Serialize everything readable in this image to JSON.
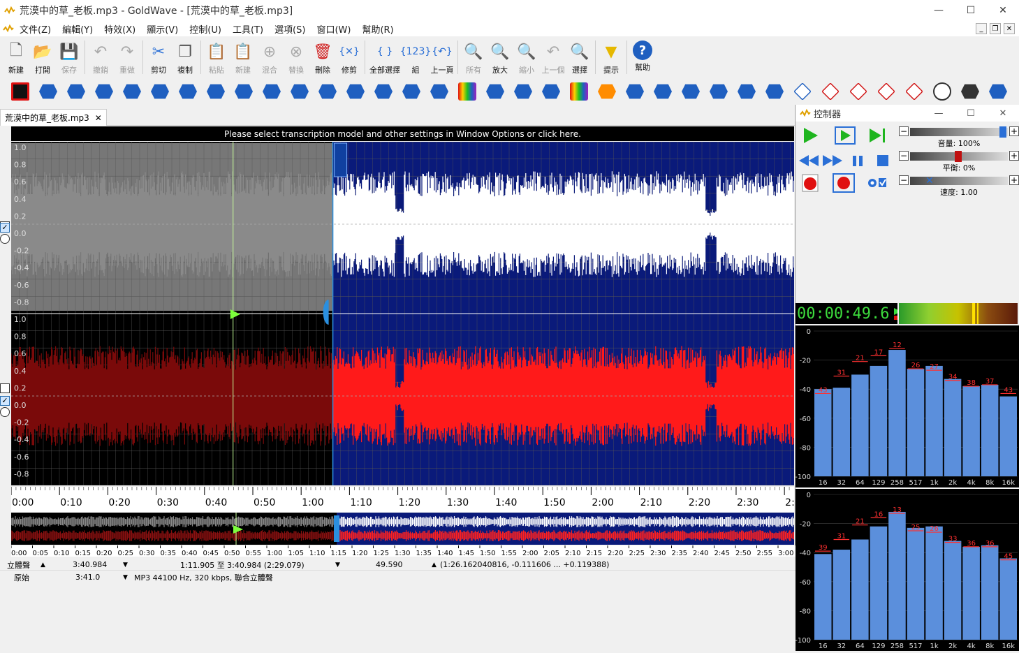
{
  "window": {
    "title": "荒漠中的草_老板.mp3 - GoldWave - [荒漠中的草_老板.mp3]",
    "controls": {
      "minimize": "—",
      "maximize": "☐",
      "close": "✕"
    }
  },
  "menu": [
    "文件(Z)",
    "編輯(Y)",
    "特效(X)",
    "顯示(V)",
    "控制(U)",
    "工具(T)",
    "選項(S)",
    "窗口(W)",
    "幫助(R)"
  ],
  "toolbar": [
    {
      "label": "新建",
      "icon": "new-file-icon",
      "glyph": "🗋",
      "enabled": true
    },
    {
      "label": "打開",
      "icon": "open-file-icon",
      "glyph": "📂",
      "enabled": true
    },
    {
      "label": "保存",
      "icon": "save-icon",
      "glyph": "💾",
      "enabled": false
    },
    {
      "label": "撤銷",
      "icon": "undo-icon",
      "glyph": "↶",
      "enabled": false
    },
    {
      "label": "重做",
      "icon": "redo-icon",
      "glyph": "↷",
      "enabled": false
    },
    {
      "label": "剪切",
      "icon": "cut-icon",
      "glyph": "✂",
      "enabled": true
    },
    {
      "label": "複制",
      "icon": "copy-icon",
      "glyph": "❐",
      "enabled": true
    },
    {
      "label": "粘貼",
      "icon": "paste-icon",
      "glyph": "📋",
      "enabled": false
    },
    {
      "label": "新建",
      "icon": "paste-new-icon",
      "glyph": "📋",
      "enabled": false
    },
    {
      "label": "混合",
      "icon": "mix-icon",
      "glyph": "⊕",
      "enabled": false
    },
    {
      "label": "替換",
      "icon": "replace-icon",
      "glyph": "⊗",
      "enabled": false
    },
    {
      "label": "刪除",
      "icon": "delete-icon",
      "glyph": "🗑",
      "enabled": true
    },
    {
      "label": "修剪",
      "icon": "trim-icon",
      "glyph": "{✕}",
      "enabled": true
    },
    {
      "label": "全部選擇",
      "icon": "select-all-icon",
      "glyph": "{ }",
      "enabled": true
    },
    {
      "label": "組",
      "icon": "set-icon",
      "glyph": "{123}",
      "enabled": true
    },
    {
      "label": "上一頁",
      "icon": "previous-icon",
      "glyph": "{↶}",
      "enabled": true
    },
    {
      "label": "所有",
      "icon": "zoom-all-icon",
      "glyph": "🔍",
      "enabled": false
    },
    {
      "label": "放大",
      "icon": "zoom-in-icon",
      "glyph": "🔍",
      "enabled": true
    },
    {
      "label": "縮小",
      "icon": "zoom-out-icon",
      "glyph": "🔍",
      "enabled": false
    },
    {
      "label": "上一個",
      "icon": "zoom-prev-icon",
      "glyph": "↶",
      "enabled": false
    },
    {
      "label": "選擇",
      "icon": "zoom-select-icon",
      "glyph": "🔍",
      "enabled": true
    },
    {
      "label": "提示",
      "icon": "cue-icon",
      "glyph": "▼",
      "enabled": true
    },
    {
      "label": "幫助",
      "icon": "help-icon",
      "glyph": "?",
      "enabled": true
    }
  ],
  "effects_toolbar_count": 36,
  "tab": {
    "label": "荒漠中的草_老板.mp3",
    "close": "✕"
  },
  "banner": "Please select transcription model and other settings in Window Options or click here.",
  "amplitude_labels": [
    "1.0",
    "0.8",
    "0.6",
    "0.4",
    "0.2",
    "0.0",
    "-0.2",
    "-0.4",
    "-0.6",
    "-0.8"
  ],
  "timeline_labels": [
    "0:00",
    "0:10",
    "0:20",
    "0:30",
    "0:40",
    "0:50",
    "1:00",
    "1:10",
    "1:20",
    "1:30",
    "1:40",
    "1:50",
    "2:00",
    "2:10",
    "2:20",
    "2:30",
    "2:40",
    "2:5"
  ],
  "overview_labels": [
    "0:00",
    "0:05",
    "0:10",
    "0:15",
    "0:20",
    "0:25",
    "0:30",
    "0:35",
    "0:40",
    "0:45",
    "0:50",
    "0:55",
    "1:00",
    "1:05",
    "1:10",
    "1:15",
    "1:20",
    "1:25",
    "1:30",
    "1:35",
    "1:40",
    "1:45",
    "1:50",
    "1:55",
    "2:00",
    "2:05",
    "2:10",
    "2:15",
    "2:20",
    "2:25",
    "2:30",
    "2:35",
    "2:40",
    "2:45",
    "2:50",
    "2:55",
    "3:00",
    "3:05",
    "3:10",
    "3:15",
    "3:20",
    "3:25",
    "3:30",
    "3:35",
    "3"
  ],
  "selection": {
    "start_seconds": 71.905,
    "end_seconds": 220.984,
    "total_seconds": 220.984,
    "playhead_seconds": 49.6
  },
  "status": {
    "channel": "立體聲",
    "length": "3:40.984",
    "selection": "1:11.905 至 3:40.984 (2:29.079)",
    "cursor": "49.590",
    "amplitude": "(1:26.162040816, -0.111606 ... +0.119388)",
    "original_label": "原始",
    "original_length": "3:41.0",
    "format": "MP3 44100 Hz, 320 kbps, 聯合立體聲"
  },
  "controller": {
    "title": "控制器",
    "volume_label": "音量: 100%",
    "balance_label": "平衡: 0%",
    "speed_label": "速度: 1.00",
    "time": "00:00:49.6",
    "spectrum_y_labels": [
      "0",
      "-20",
      "-40",
      "-60",
      "-80",
      "-100"
    ],
    "spectrum_x_labels": [
      "16",
      "32",
      "64",
      "129",
      "258",
      "517",
      "1k",
      "2k",
      "4k",
      "8k",
      "16k"
    ],
    "spectrum_top_values": [
      43,
      31,
      21,
      17,
      12,
      26,
      27,
      34,
      38,
      37,
      43
    ],
    "spectrum_bottom_values": [
      39,
      31,
      21,
      16,
      13,
      25,
      26,
      33,
      36,
      36,
      45
    ],
    "spectrum_top_levels": [
      -40,
      -39,
      -30,
      -24,
      -13,
      -26,
      -24,
      -33,
      -38,
      -37,
      -45
    ],
    "spectrum_bottom_levels": [
      -41,
      -38,
      -31,
      -22,
      -12,
      -23,
      -22,
      -32,
      -36,
      -35,
      -44
    ]
  },
  "colors": {
    "selection_bg": "#0a1a7a",
    "left_selected": "#ffffff",
    "right_selected": "#ff1a1a",
    "left_unselected": "#8a8a8a",
    "right_unselected": "#7a0a0a",
    "spectrum_bar": "#5b8fdc",
    "peak": "#ff3030"
  }
}
